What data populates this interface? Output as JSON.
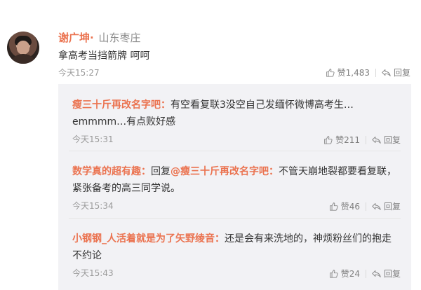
{
  "main_comment": {
    "username": "谢广坤·",
    "location": "山东枣庄",
    "text": "拿高考当挡箭牌 呵呵",
    "time": "今天15:27",
    "like_label": "赞1,483",
    "reply_label": "回复"
  },
  "replies": [
    {
      "username": "瘦三十斤再改名字吧：",
      "text_before": "有空看复联3没空自己发缅怀微博高考生…emmmm…有点败好感",
      "mention": "",
      "text_after": "",
      "time": "今天15:31",
      "like_label": "赞211",
      "reply_label": "回复"
    },
    {
      "username": "数学真的超有趣：",
      "text_before": "回复",
      "mention": "@瘦三十斤再改名字吧：",
      "text_after": "不管天崩地裂都要看复联，紧张备考的高三同学说。",
      "time": "今天15:34",
      "like_label": "赞46",
      "reply_label": "回复"
    },
    {
      "username": "小钢钢_人活着就是为了矢野绫音：",
      "text_before": "还是会有来洗地的，神烦粉丝们的抱走不约论",
      "mention": "",
      "text_after": "",
      "time": "今天15:43",
      "like_label": "赞24",
      "reply_label": "回复"
    }
  ],
  "icons": {
    "like": "thumbs-up-icon",
    "reply": "reply-arrow-icon"
  },
  "colors": {
    "username": "#eb7350",
    "reply_bg": "#f2f2f5",
    "meta": "#9a9a9a"
  }
}
